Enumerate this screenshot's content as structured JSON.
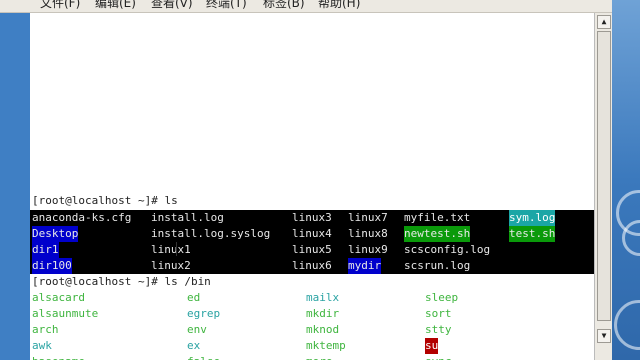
{
  "menu": [
    "文件(F)",
    "编辑(E)",
    "查看(V)",
    "终端(T)",
    "标签(B)",
    "帮助(H)"
  ],
  "terminal": {
    "prompt1": "[root@localhost ~]# ls",
    "ls_rows": [
      [
        "anaconda-ks.cfg",
        "install.log",
        "linux3",
        "linux7",
        "myfile.txt",
        "sym.log"
      ],
      [
        "Desktop",
        "install.log.syslog",
        "linux4",
        "linux8",
        "newtest.sh",
        "test.sh"
      ],
      [
        "dir1",
        "linux1",
        "linux5",
        "linux9",
        "scsconfig.log",
        ""
      ],
      [
        "dir100",
        "linux2",
        "linux6",
        "mydir",
        "scsrun.log",
        ""
      ]
    ],
    "prompt2": "[root@localhost ~]# ls /bin",
    "bin_rows": [
      [
        "alsacard",
        "ed",
        "mailx",
        "sleep"
      ],
      [
        "alsaunmute",
        "egrep",
        "mkdir",
        "sort"
      ],
      [
        "arch",
        "env",
        "mknod",
        "stty"
      ],
      [
        "awk",
        "ex",
        "mktemp",
        "su"
      ],
      [
        "basename",
        "false",
        "more",
        "sync"
      ]
    ]
  },
  "scrollbar": {
    "up_icon": "▲",
    "down_icon": "▼"
  },
  "colors": {
    "terminal_bg": "#ffffff",
    "ls_block_bg": "#000000",
    "directory_blue": "#0000cc",
    "executable_green": "#0a9a0a",
    "symlink_cyan": "#1aa6a6",
    "setuid_red": "#b30000",
    "bin_green": "#3fb53f",
    "bin_cyan": "#2aa3a3"
  }
}
